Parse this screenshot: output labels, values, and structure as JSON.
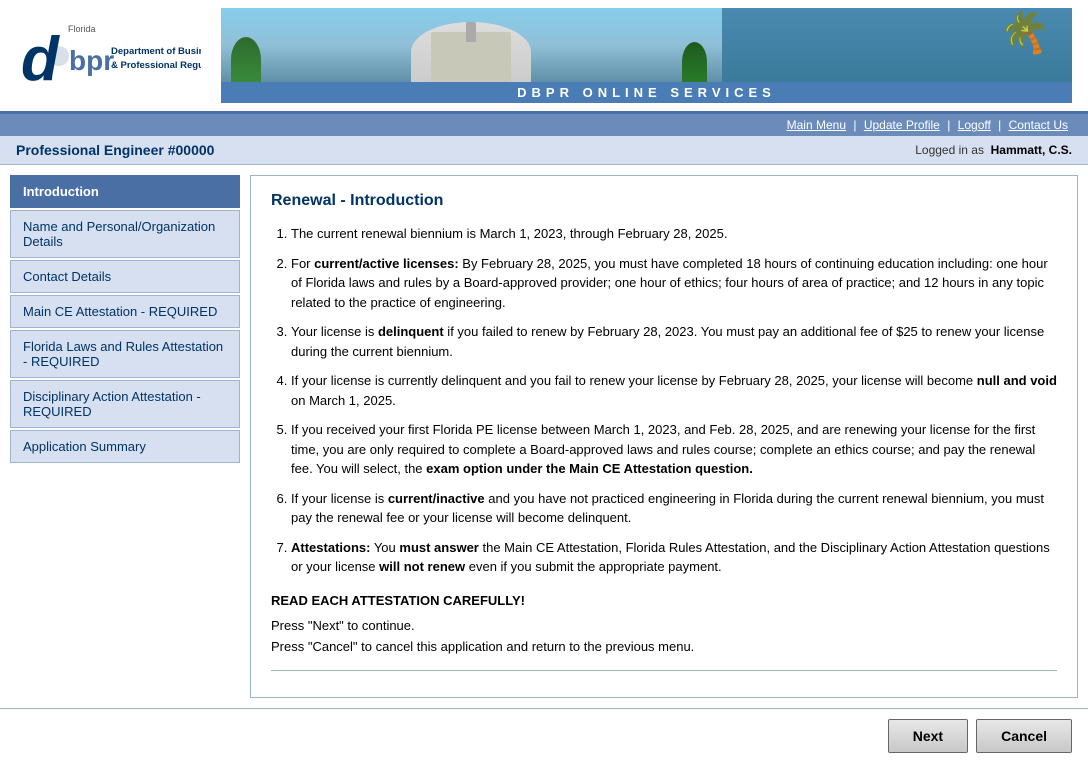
{
  "header": {
    "logo_line1": "Florida",
    "logo_line2": "dbpr",
    "logo_sub": "Department of Business\n& Professional Regulation",
    "banner_text": "DBPR   ONLINE   SERVICES"
  },
  "nav": {
    "main_menu": "Main Menu",
    "update_profile": "Update Profile",
    "logoff": "Logoff",
    "contact_us": "Contact Us"
  },
  "sub_header": {
    "license": "Professional Engineer #00000",
    "logged_in_label": "Logged in as",
    "user": "Hammatt, C.S."
  },
  "sidebar": {
    "items": [
      {
        "id": "introduction",
        "label": "Introduction",
        "active": true
      },
      {
        "id": "name-personal",
        "label": "Name and Personal/Organization Details",
        "active": false
      },
      {
        "id": "contact-details",
        "label": "Contact Details",
        "active": false
      },
      {
        "id": "main-ce",
        "label": "Main CE Attestation - REQUIRED",
        "active": false
      },
      {
        "id": "florida-laws",
        "label": "Florida Laws and Rules Attestation - REQUIRED",
        "active": false
      },
      {
        "id": "disciplinary",
        "label": "Disciplinary Action Attestation - REQUIRED",
        "active": false
      },
      {
        "id": "app-summary",
        "label": "Application Summary",
        "active": false
      }
    ]
  },
  "content": {
    "title": "Renewal - Introduction",
    "items": [
      {
        "id": 1,
        "text": "The current renewal biennium is March 1, 2023, through February 28, 2025."
      },
      {
        "id": 2,
        "prefix": "For ",
        "bold_part": "current/active licenses:",
        "suffix": " By February 28, 2025, you must have completed 18 hours of continuing education including: one hour of Florida laws and rules by a Board-approved provider; one hour of ethics; four hours of area of practice; and 12 hours in any topic related to the practice of engineering."
      },
      {
        "id": 3,
        "prefix": "Your license is ",
        "bold_part": "delinquent",
        "suffix": " if you failed to renew by February 28, 2023. You must pay an additional fee of $25 to renew your license during the current biennium."
      },
      {
        "id": 4,
        "prefix": "If your license is currently delinquent and you fail to renew your license by February 28, 2025, your license will become ",
        "bold_part": "null and void",
        "suffix": " on March 1, 2025."
      },
      {
        "id": 5,
        "text": "If you received your first Florida PE license between March 1, 2023, and Feb. 28, 2025, and are renewing your license for the first time, you are only required to complete a Board-approved laws and rules course; complete an ethics course; and pay the renewal fee. You will select, the ",
        "bold_end": "exam option under the Main CE Attestation question."
      },
      {
        "id": 6,
        "prefix": "If your license is ",
        "bold_part": "current/inactive",
        "suffix": " and you have not practiced engineering in Florida during the current renewal biennium, you must pay the renewal fee or your license will become delinquent."
      },
      {
        "id": 7,
        "prefix": "Attestations: You ",
        "bold1": "must answer",
        "middle": " the Main CE Attestation, Florida Rules Attestation, and the Disciplinary Action Attestation questions or your license ",
        "bold2": "will not renew",
        "suffix": " even if you submit the appropriate payment."
      }
    ],
    "read_notice": "READ EACH ATTESTATION CAREFULLY!",
    "press_next": "Press \"Next\" to continue.",
    "press_cancel": "Press \"Cancel\" to cancel this application and return to the previous menu."
  },
  "buttons": {
    "next": "Next",
    "cancel": "Cancel"
  }
}
